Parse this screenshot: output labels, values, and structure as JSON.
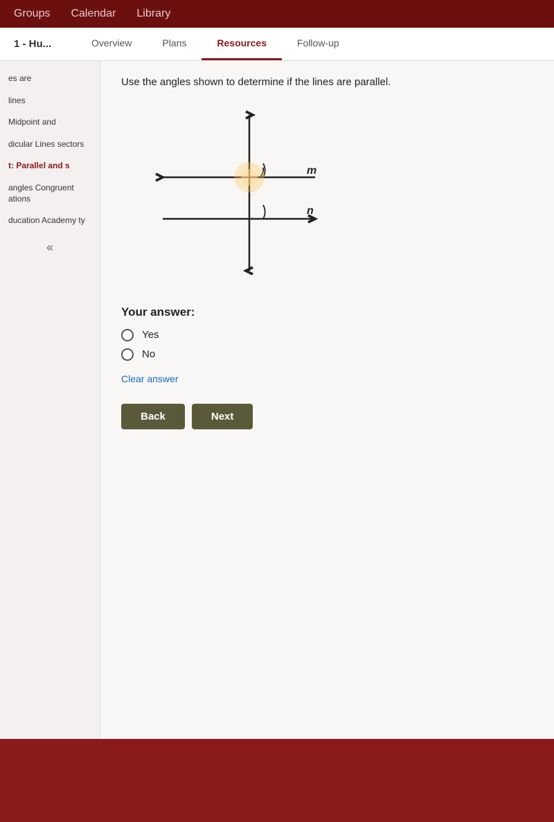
{
  "topNav": {
    "items": [
      "Groups",
      "Calendar",
      "Library"
    ]
  },
  "secondNav": {
    "title": "1 - Hu...",
    "tabs": [
      "Overview",
      "Plans",
      "Resources",
      "Follow-up"
    ],
    "activeTab": "Resources"
  },
  "sidebar": {
    "items": [
      {
        "label": "es are",
        "active": false
      },
      {
        "label": "lines",
        "active": false
      },
      {
        "label": "Midpoint and",
        "active": false
      },
      {
        "label": "dicular Lines sectors",
        "active": false
      },
      {
        "label": "t: Parallel and s",
        "active": true
      },
      {
        "label": "angles Congruent ations",
        "active": false
      },
      {
        "label": "ducation Academy ty",
        "active": false
      }
    ],
    "collapseIcon": "«"
  },
  "content": {
    "questionText": "Use the angles shown to determine if the lines are parallel.",
    "diagramLabels": {
      "lineM": "m",
      "lineN": "n"
    },
    "answerLabel": "Your answer:",
    "options": [
      {
        "label": "Yes",
        "value": "yes"
      },
      {
        "label": "No",
        "value": "no"
      }
    ],
    "clearAnswerLabel": "Clear answer",
    "buttons": {
      "back": "Back",
      "next": "Next"
    }
  }
}
